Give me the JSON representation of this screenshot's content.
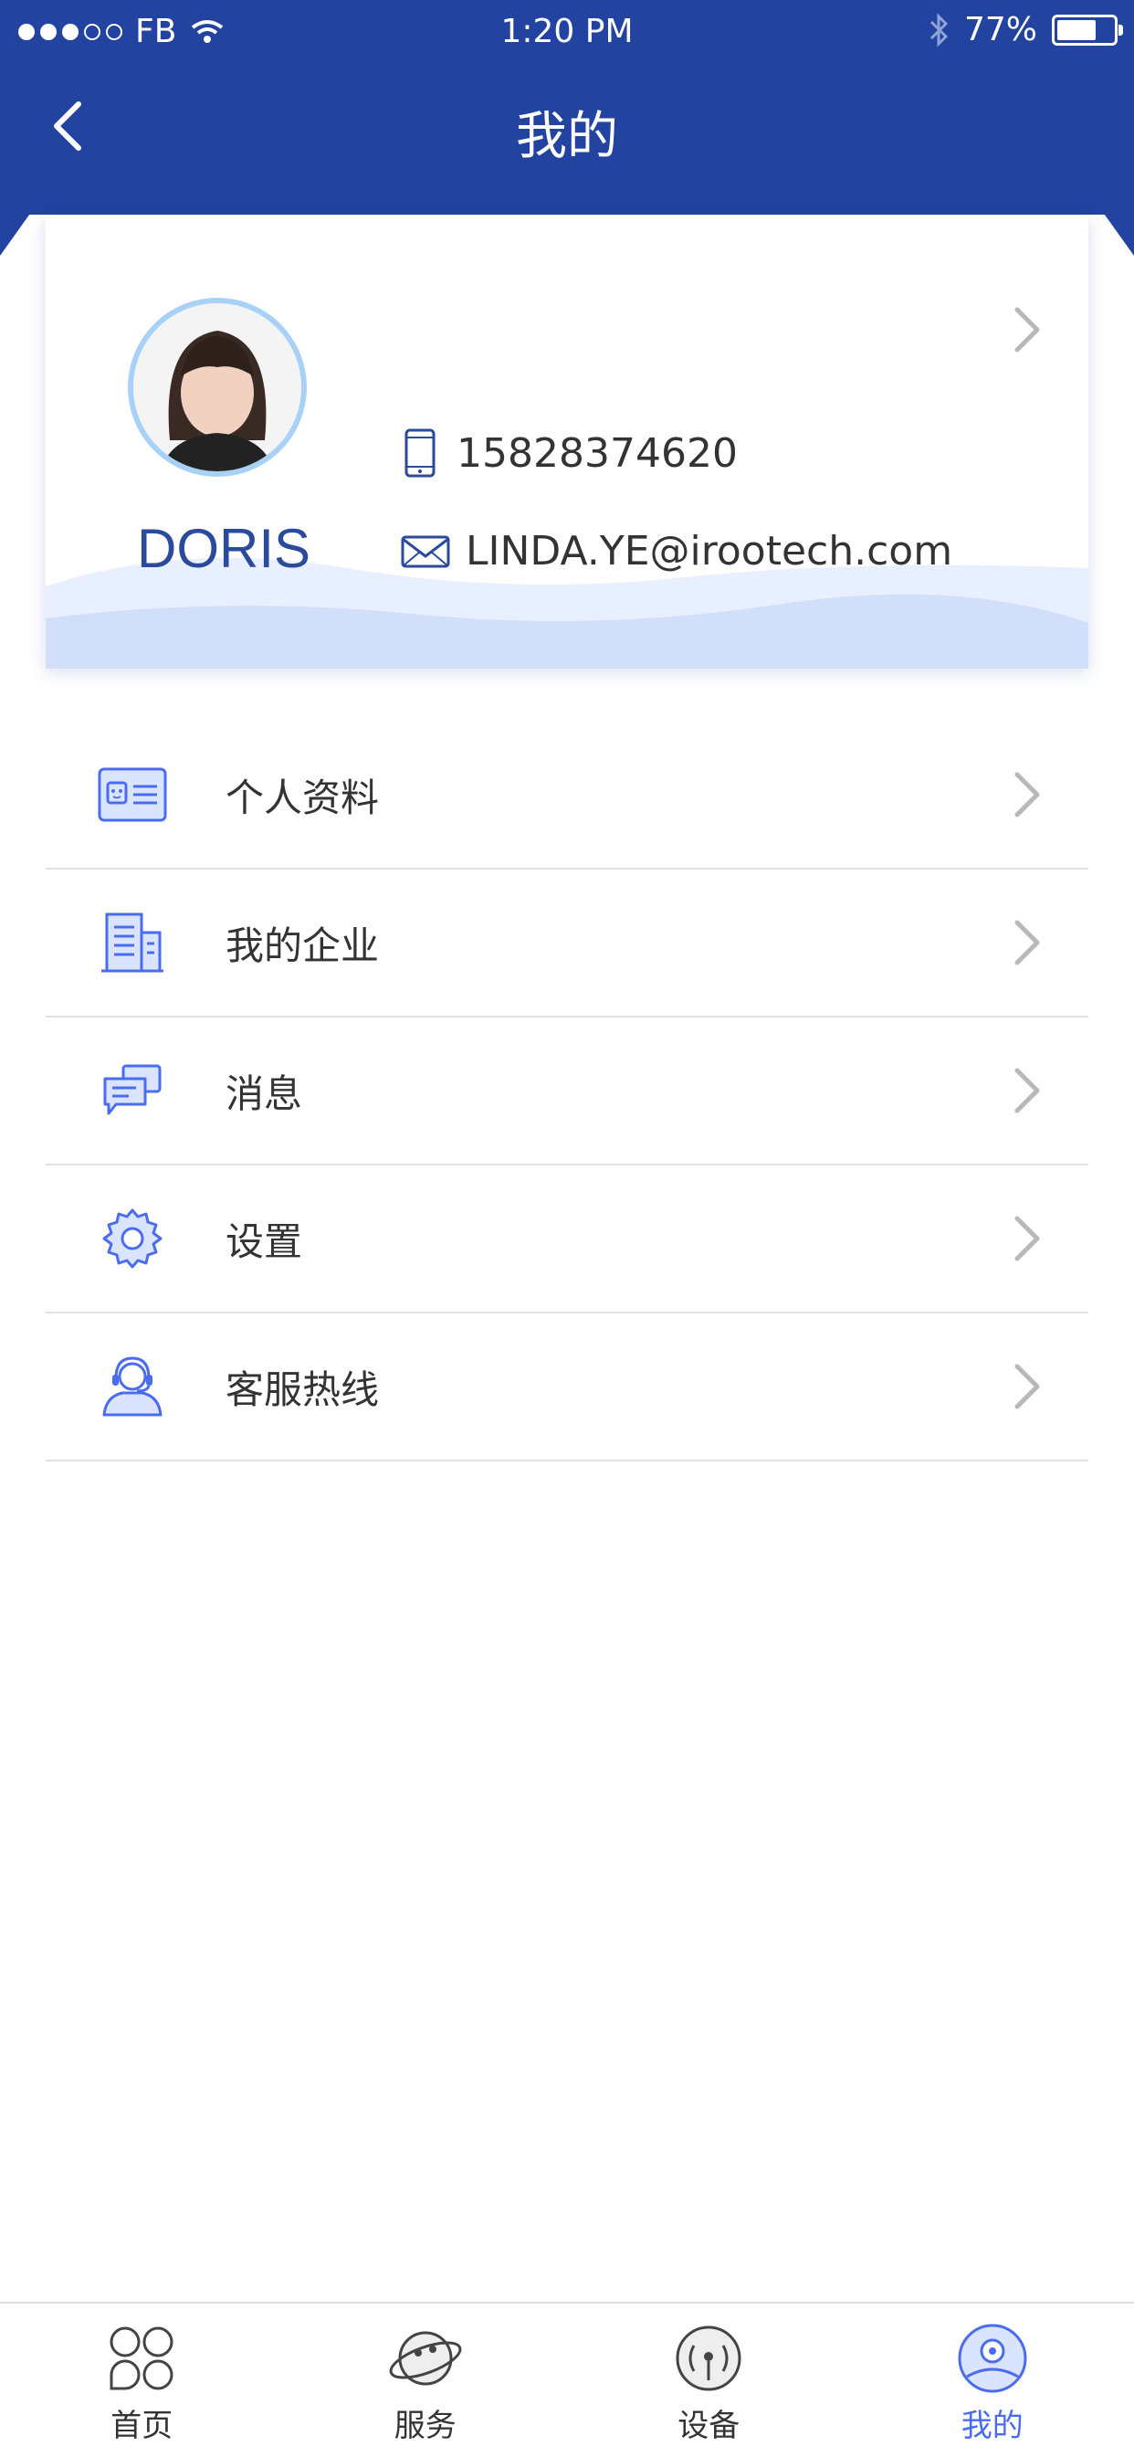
{
  "status_bar": {
    "carrier": "FB",
    "time": "1:20 PM",
    "battery": "77%",
    "battery_level": 0.77
  },
  "header": {
    "title": "我的"
  },
  "profile": {
    "name": "DORIS",
    "phone": "15828374620",
    "email": "LINDA.YE@irootech.com"
  },
  "menu": {
    "items": [
      {
        "label": "个人资料",
        "icon": "id-card-icon"
      },
      {
        "label": "我的企业",
        "icon": "building-icon"
      },
      {
        "label": "消息",
        "icon": "message-icon"
      },
      {
        "label": "设置",
        "icon": "gear-icon"
      },
      {
        "label": "客服热线",
        "icon": "headset-icon"
      }
    ]
  },
  "tabbar": {
    "tabs": [
      {
        "label": "首页",
        "icon": "home-grid-icon"
      },
      {
        "label": "服务",
        "icon": "planet-icon"
      },
      {
        "label": "设备",
        "icon": "signal-icon"
      },
      {
        "label": "我的",
        "icon": "profile-icon",
        "active": true
      }
    ]
  },
  "colors": {
    "header": "#2343a1",
    "accent": "#4a6cf0",
    "name": "#2a4a9c",
    "avatar_ring": "#a8d1f7"
  }
}
